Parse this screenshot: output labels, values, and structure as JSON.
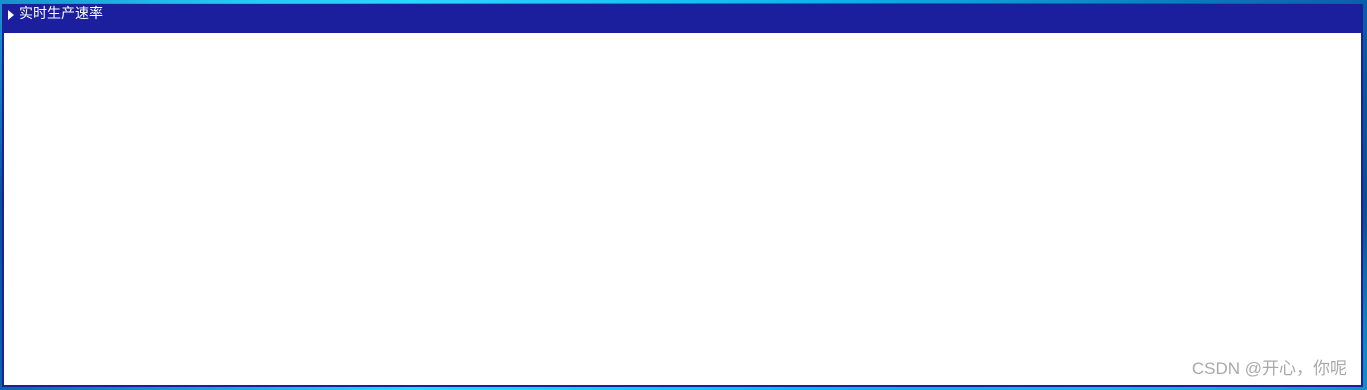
{
  "panel": {
    "title": "实时生产速率",
    "expand_icon": "triangle-right-icon"
  },
  "watermark": {
    "text": "CSDN @开心，你呢"
  },
  "colors": {
    "header_bg": "#1b1f9e",
    "panel_bg": "#ffffff",
    "title_text": "#ffffff",
    "watermark_text": "#a9a9a9",
    "page_bg": "#0b4f93"
  }
}
